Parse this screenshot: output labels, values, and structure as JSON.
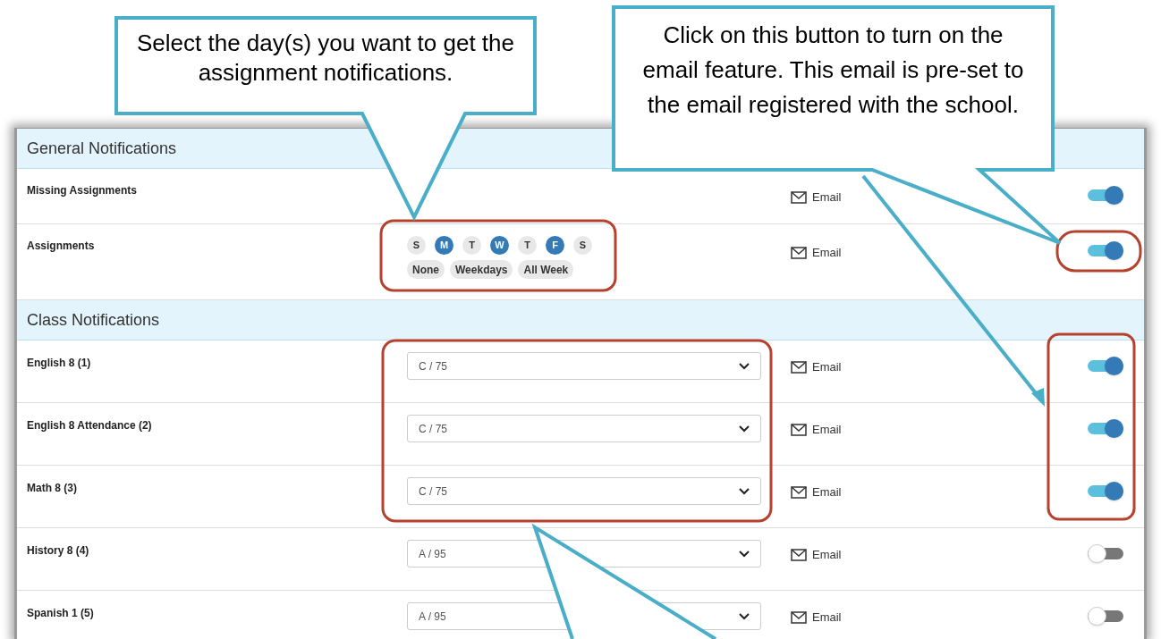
{
  "callouts": [
    {
      "text": "Select the day(s) you want to get the assignment notifications."
    },
    {
      "text": "Click on this button to turn on the email feature. This email is pre-set to the email registered with the school."
    }
  ],
  "sections": [
    {
      "title": "General Notifications",
      "rows": [
        {
          "label": "Missing Assignments",
          "kind": "plain",
          "email": "Email",
          "on": true
        },
        {
          "label": "Assignments",
          "kind": "days",
          "days": [
            {
              "letter": "S",
              "selected": false
            },
            {
              "letter": "M",
              "selected": true
            },
            {
              "letter": "T",
              "selected": false
            },
            {
              "letter": "W",
              "selected": true
            },
            {
              "letter": "T",
              "selected": false
            },
            {
              "letter": "F",
              "selected": true
            },
            {
              "letter": "S",
              "selected": false
            }
          ],
          "presets": [
            "None",
            "Weekdays",
            "All Week"
          ],
          "email": "Email",
          "on": true
        }
      ]
    },
    {
      "title": "Class Notifications",
      "rows": [
        {
          "label": "English 8 (1)",
          "kind": "select",
          "value": "C / 75",
          "email": "Email",
          "on": true
        },
        {
          "label": "English 8 Attendance (2)",
          "kind": "select",
          "value": "C / 75",
          "email": "Email",
          "on": true
        },
        {
          "label": "Math 8 (3)",
          "kind": "select",
          "value": "C / 75",
          "email": "Email",
          "on": true
        },
        {
          "label": "History 8 (4)",
          "kind": "select",
          "value": "A / 95",
          "email": "Email",
          "on": false
        },
        {
          "label": "Spanish 1 (5)",
          "kind": "select",
          "value": "A / 95",
          "email": "Email",
          "on": false
        }
      ]
    }
  ]
}
